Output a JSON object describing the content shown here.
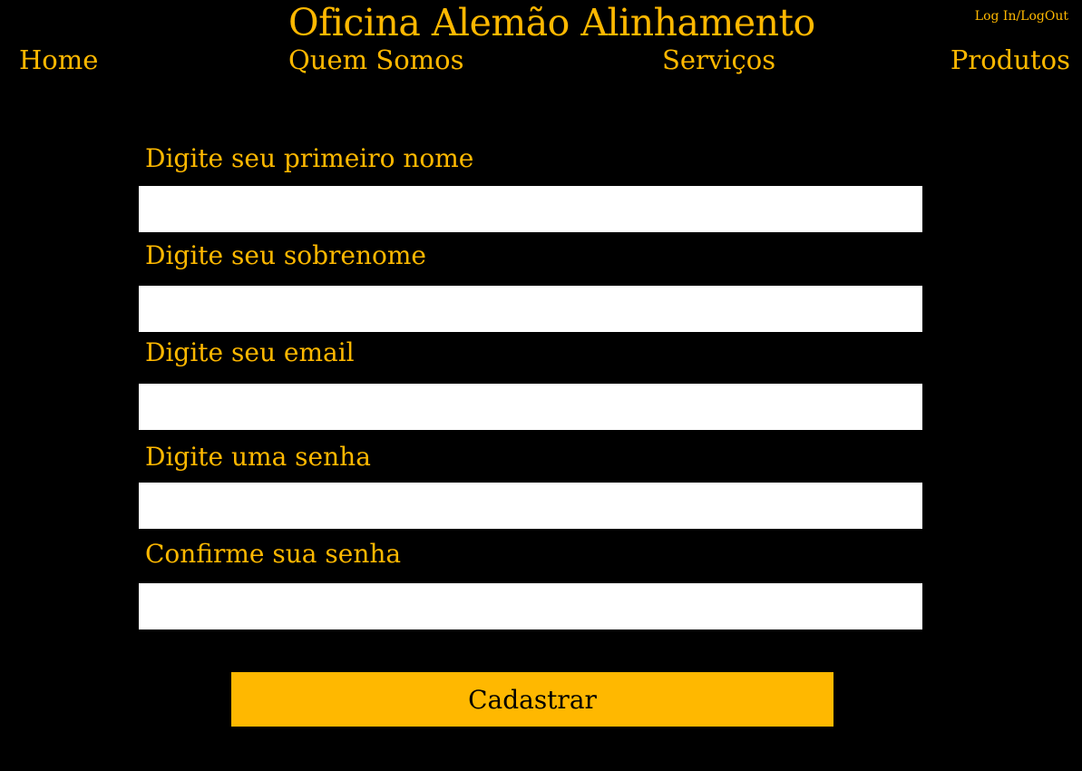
{
  "header": {
    "title": "Oficina Alemão Alinhamento",
    "login_label": "Log In/LogOut"
  },
  "nav": {
    "items": [
      {
        "label": "Home"
      },
      {
        "label": "Quem Somos"
      },
      {
        "label": "Serviços"
      },
      {
        "label": "Produtos"
      }
    ]
  },
  "form": {
    "fields": [
      {
        "label": "Digite seu primeiro nome",
        "value": ""
      },
      {
        "label": "Digite seu sobrenome",
        "value": ""
      },
      {
        "label": "Digite seu email",
        "value": ""
      },
      {
        "label": "Digite uma senha",
        "value": ""
      },
      {
        "label": "Confirme sua senha",
        "value": ""
      }
    ],
    "submit_label": "Cadastrar"
  },
  "colors": {
    "background": "#000000",
    "accent": "#FFB800",
    "input_background": "#FFFFFF",
    "button_text": "#000000"
  }
}
